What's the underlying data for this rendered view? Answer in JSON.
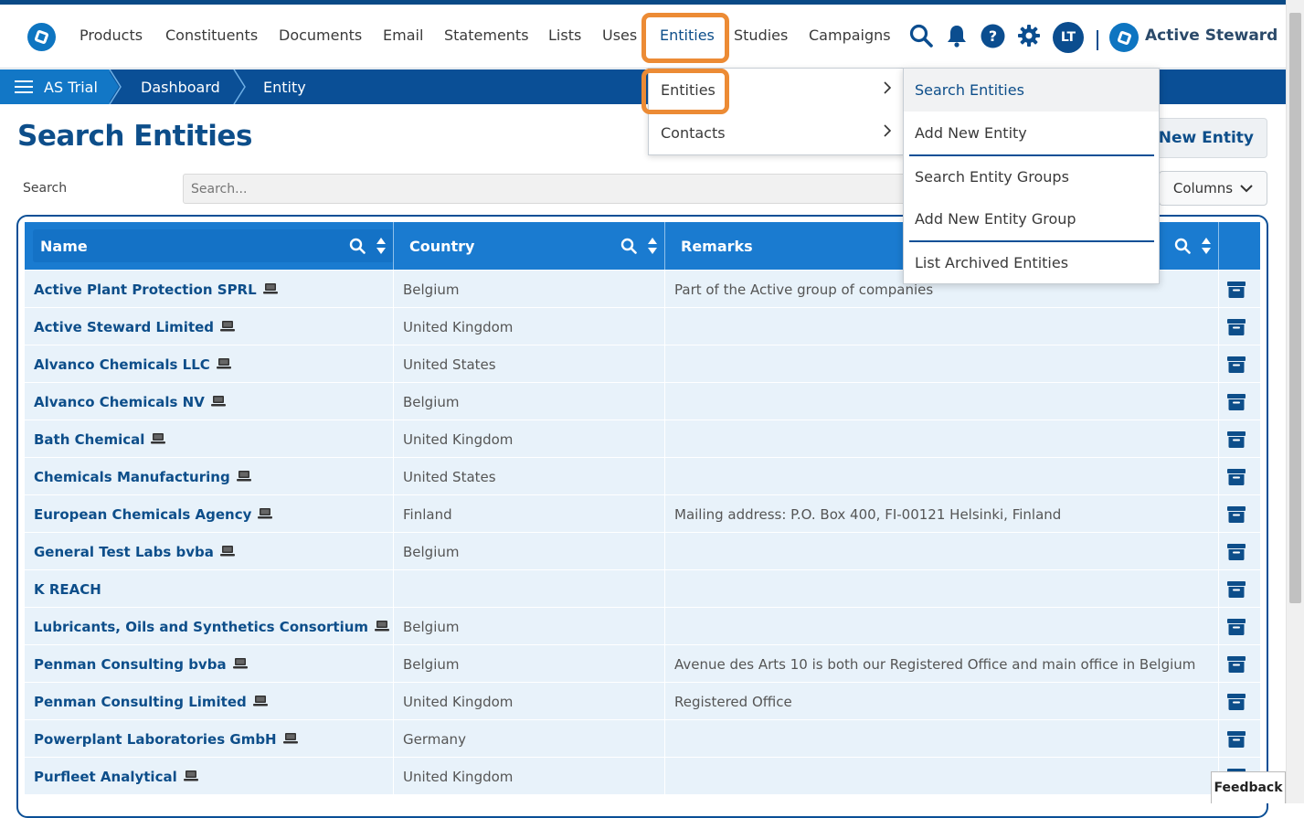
{
  "nav": {
    "items": [
      "Products",
      "Constituents",
      "Documents",
      "Email",
      "Statements",
      "Lists",
      "Uses",
      "Entities",
      "Studies",
      "Campaigns"
    ],
    "avatar_initials": "LT",
    "brand": "Active Steward"
  },
  "breadcrumb": {
    "items": [
      "AS Trial",
      "Dashboard",
      "Entity"
    ]
  },
  "page": {
    "title": "Search Entities",
    "search_label": "Search",
    "search_placeholder": "Search...",
    "add_button": "Add New Entity",
    "columns_button": "Columns"
  },
  "table": {
    "headers": [
      "Name",
      "Country",
      "Remarks"
    ],
    "rows": [
      {
        "name": "Active Plant Protection SPRL",
        "country": "Belgium",
        "remarks": "Part of the Active group of companies",
        "laptop": true
      },
      {
        "name": "Active Steward Limited",
        "country": "United Kingdom",
        "remarks": "",
        "laptop": true
      },
      {
        "name": "Alvanco Chemicals LLC",
        "country": "United States",
        "remarks": "",
        "laptop": true
      },
      {
        "name": "Alvanco Chemicals NV",
        "country": "Belgium",
        "remarks": "",
        "laptop": true
      },
      {
        "name": "Bath Chemical",
        "country": "United Kingdom",
        "remarks": "",
        "laptop": true
      },
      {
        "name": "Chemicals Manufacturing",
        "country": "United States",
        "remarks": "",
        "laptop": true
      },
      {
        "name": "European Chemicals Agency",
        "country": "Finland",
        "remarks": "Mailing address: P.O. Box 400, FI-00121 Helsinki, Finland",
        "laptop": true
      },
      {
        "name": "General Test Labs bvba",
        "country": "Belgium",
        "remarks": "",
        "laptop": true
      },
      {
        "name": "K REACH",
        "country": "",
        "remarks": "",
        "laptop": false
      },
      {
        "name": "Lubricants, Oils and Synthetics Consortium",
        "country": "Belgium",
        "remarks": "",
        "laptop": true
      },
      {
        "name": "Penman Consulting bvba",
        "country": "Belgium",
        "remarks": "Avenue des Arts 10 is both our Registered Office and main office in Belgium",
        "laptop": true
      },
      {
        "name": "Penman Consulting Limited",
        "country": "United Kingdom",
        "remarks": "Registered Office",
        "laptop": true
      },
      {
        "name": "Powerplant Laboratories GmbH",
        "country": "Germany",
        "remarks": "",
        "laptop": true
      },
      {
        "name": "Purfleet Analytical",
        "country": "United Kingdom",
        "remarks": "",
        "laptop": true
      }
    ]
  },
  "menu_level1": {
    "items": [
      "Entities",
      "Contacts"
    ]
  },
  "menu_level2": {
    "items": [
      "Search Entities",
      "Add New Entity",
      "Search Entity Groups",
      "Add New Entity Group",
      "List Archived Entities"
    ]
  },
  "feedback": "Feedback",
  "colors": {
    "primary": "#0a4f96",
    "accent": "#1277c6",
    "highlight": "#ec8b35",
    "row_bg": "#e8f2fa"
  }
}
